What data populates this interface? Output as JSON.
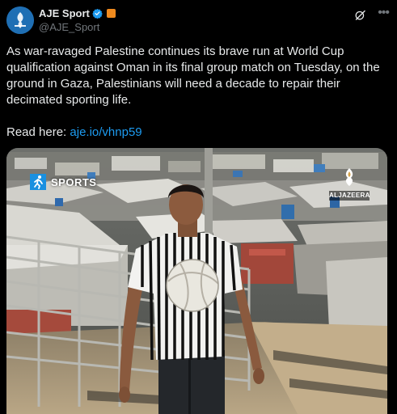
{
  "post": {
    "author": {
      "display_name": "AJE Sport",
      "handle": "@AJE_Sport",
      "avatar_icon": "aje-sport-avatar",
      "verified_icon": "verified-badge-icon",
      "affiliate_icon": "al-jazeera-affiliate-icon"
    },
    "actions": {
      "grok_icon": "grok-icon",
      "more_icon": "more-options-icon"
    },
    "text": "As war-ravaged Palestine continues its brave run at World Cup qualification against Oman in its final group match on Tuesday, on the ground in Gaza, Palestinians will need a decade to repair their decimated sporting life.",
    "read_here_label": "Read here:",
    "link_text": "aje.io/vhnp59"
  },
  "media": {
    "badge_label": "SPORTS",
    "badge_icon": "sports-runner-icon",
    "watermark": "ALJAZEERA",
    "watermark_icon": "al-jazeera-emblem-icon"
  },
  "colors": {
    "background": "#000000",
    "text": "#e7e9ea",
    "secondary": "#71767b",
    "link": "#1d9bf0",
    "verified": "#1d9bf0",
    "sports_badge": "#1a90e0"
  }
}
